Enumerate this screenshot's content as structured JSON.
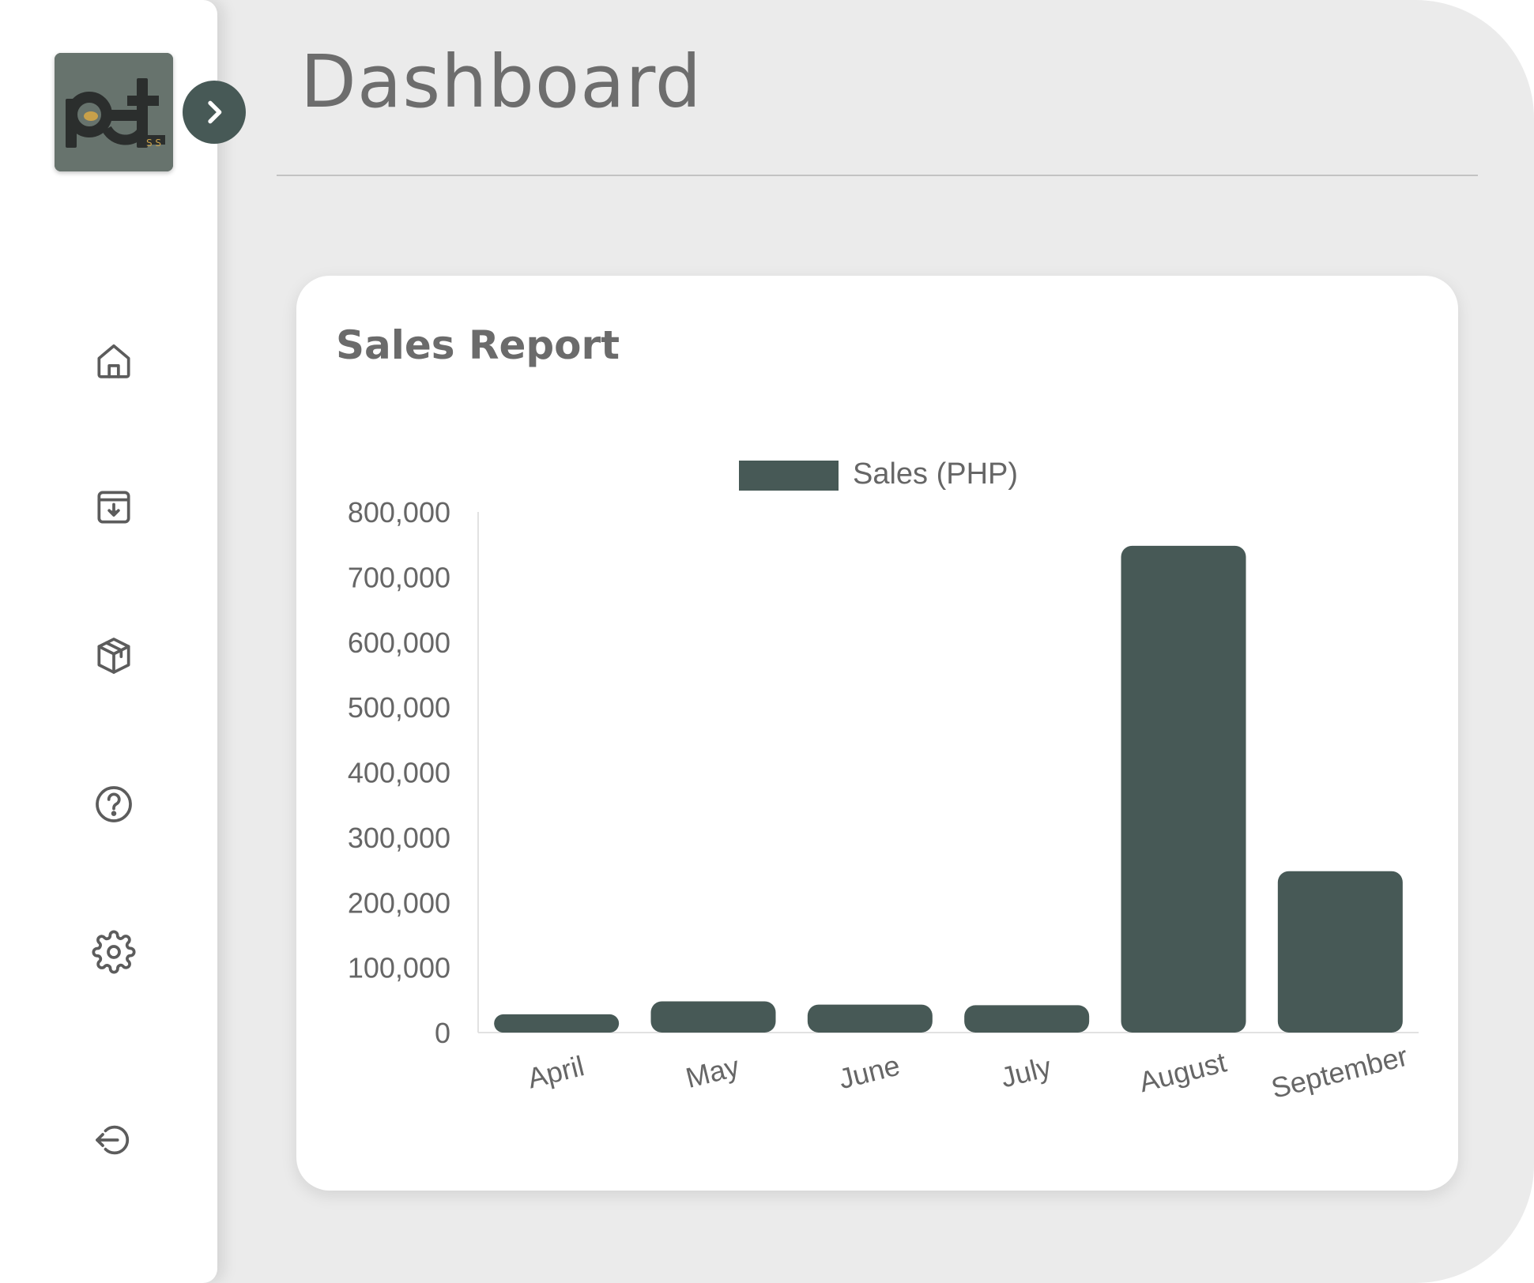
{
  "page": {
    "title": "Dashboard"
  },
  "sidebar": {
    "toggle": "expand",
    "items": [
      {
        "name": "home",
        "icon": "home-icon"
      },
      {
        "name": "inventory",
        "icon": "archive-download-icon"
      },
      {
        "name": "products",
        "icon": "box-icon"
      },
      {
        "name": "help",
        "icon": "help-circle-icon"
      },
      {
        "name": "settings",
        "icon": "gear-icon"
      },
      {
        "name": "logout",
        "icon": "logout-icon"
      }
    ]
  },
  "colors": {
    "accent": "#475956",
    "background": "#ebebeb",
    "card": "#ffffff",
    "text": "#6d6d6d"
  },
  "card": {
    "title": "Sales Report"
  },
  "chart_data": {
    "type": "bar",
    "categories": [
      "April",
      "May",
      "June",
      "July",
      "August",
      "September"
    ],
    "series": [
      {
        "name": "Sales (PHP)",
        "values": [
          28000,
          48000,
          43000,
          42000,
          748000,
          248000
        ]
      }
    ],
    "ylim": [
      0,
      800000
    ],
    "yticks": [
      "0",
      "100,000",
      "200,000",
      "300,000",
      "400,000",
      "500,000",
      "600,000",
      "700,000",
      "800,000"
    ],
    "grid": false,
    "legend": "top-center",
    "color": "#475956"
  }
}
